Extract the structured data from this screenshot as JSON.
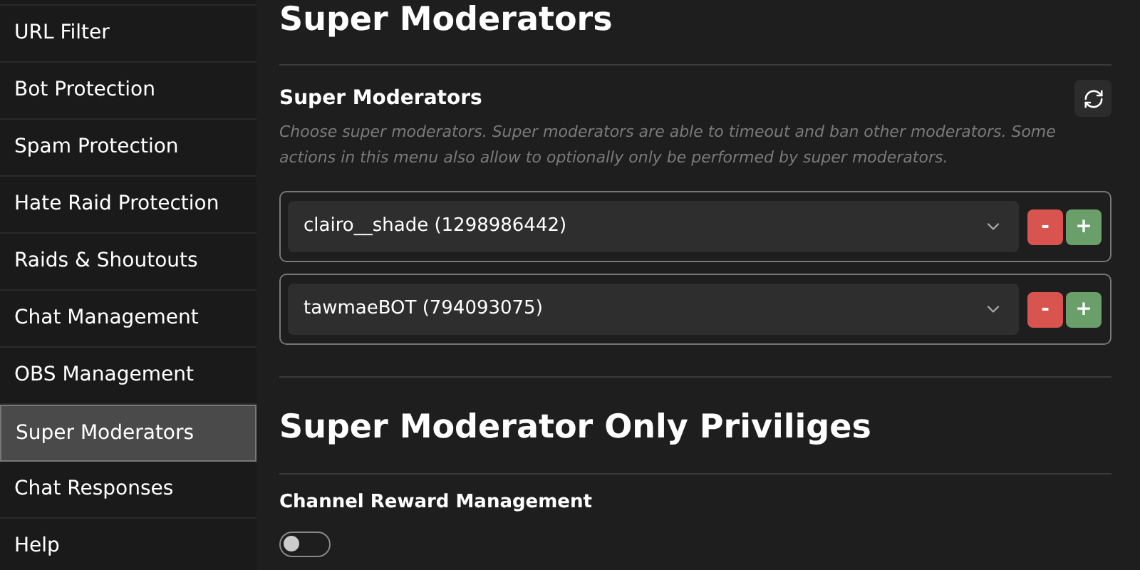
{
  "sidebar": {
    "items": [
      {
        "label": "URL Filter",
        "selected": false
      },
      {
        "label": "Bot Protection",
        "selected": false
      },
      {
        "label": "Spam Protection",
        "selected": false
      },
      {
        "label": "Hate Raid Protection",
        "selected": false
      },
      {
        "label": "Raids & Shoutouts",
        "selected": false
      },
      {
        "label": "Chat Management",
        "selected": false
      },
      {
        "label": "OBS Management",
        "selected": false
      },
      {
        "label": "Super Moderators",
        "selected": true
      },
      {
        "label": "Chat Responses",
        "selected": false
      },
      {
        "label": "Help",
        "selected": false
      }
    ]
  },
  "page_title": "Super Moderators",
  "section": {
    "title": "Super Moderators",
    "description": "Choose super moderators. Super moderators are able to timeout and ban other moderators. Some actions in this menu also allow to optionally only be performed by super moderators.",
    "moderators": [
      {
        "value": "clairo__shade (1298986442)",
        "remove": "-",
        "add": "+"
      },
      {
        "value": "tawmaeBOT (794093075)",
        "remove": "-",
        "add": "+"
      }
    ]
  },
  "privileges": {
    "title": "Super Moderator Only Priviliges",
    "settings": [
      {
        "label": "Channel Reward Management",
        "on": false
      }
    ]
  }
}
